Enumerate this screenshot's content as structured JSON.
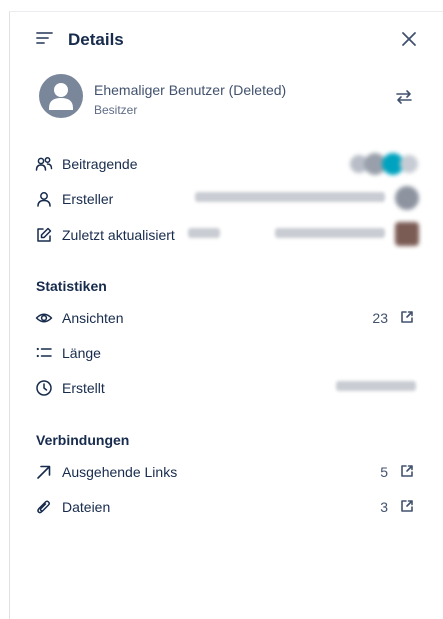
{
  "header": {
    "title": "Details",
    "menu_icon": "list-lines-icon",
    "close_icon": "close-icon"
  },
  "owner": {
    "name": "Ehemaliger Benutzer (Deleted)",
    "role": "Besitzer",
    "avatar_icon": "person-avatar-icon",
    "swap_icon": "swap-arrows-icon"
  },
  "people": [
    {
      "label": "Beitragende",
      "icon": "people-icon"
    },
    {
      "label": "Ersteller",
      "icon": "person-icon"
    },
    {
      "label": "Zuletzt aktualisiert",
      "icon": "edit-icon"
    }
  ],
  "stats": {
    "title": "Statistiken",
    "items": [
      {
        "label": "Ansichten",
        "value": "23",
        "icon": "eye-icon"
      },
      {
        "label": "Länge",
        "value": "",
        "icon": "list-icon"
      },
      {
        "label": "Erstellt",
        "value": "",
        "icon": "clock-icon"
      }
    ]
  },
  "connections": {
    "title": "Verbindungen",
    "items": [
      {
        "label": "Ausgehende Links",
        "value": "5",
        "icon": "arrow-up-right-icon"
      },
      {
        "label": "Dateien",
        "value": "3",
        "icon": "paperclip-icon"
      }
    ]
  },
  "colors": {
    "text": "#172b4d",
    "muted": "#5e6c84",
    "avatar": "#7a869a",
    "accent": "#00a3bf"
  }
}
